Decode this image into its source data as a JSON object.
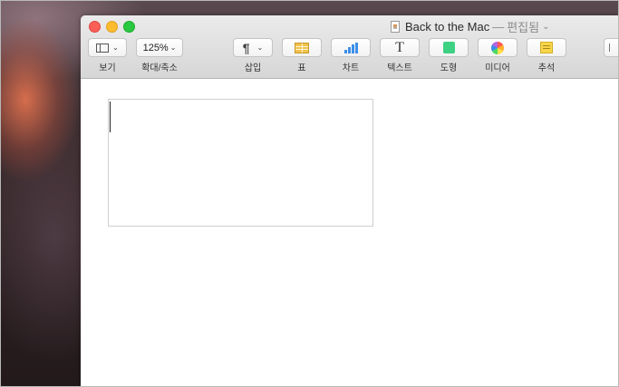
{
  "window": {
    "title": "Back to the Mac",
    "title_separator": "—",
    "status": "편집됨",
    "title_chevron": "⌄"
  },
  "toolbar": {
    "view_label": "보기",
    "zoom_value": "125%",
    "zoom_label": "확대/축소",
    "insert_label": "삽입",
    "table_label": "표",
    "chart_label": "차트",
    "text_label": "텍스트",
    "shape_label": "도형",
    "media_label": "미디어",
    "comment_label": "추석",
    "insert_icon_glyph": "¶",
    "text_icon_glyph": "T",
    "chevron_glyph": "⌄"
  },
  "icons": {
    "view": "sidebar-view-icon",
    "insert": "paragraph-icon",
    "table": "table-icon",
    "chart": "bar-chart-icon",
    "text": "text-icon",
    "shape": "shape-icon",
    "media": "photos-icon",
    "comment": "note-icon"
  },
  "colors": {
    "close": "#fc5f57",
    "minimize": "#fdbc2e",
    "zoom": "#28c840",
    "chart_accent": "#3c8ee8",
    "shape_accent": "#3dd184",
    "table_accent": "#f3c24a",
    "note_accent": "#f8d64a"
  }
}
